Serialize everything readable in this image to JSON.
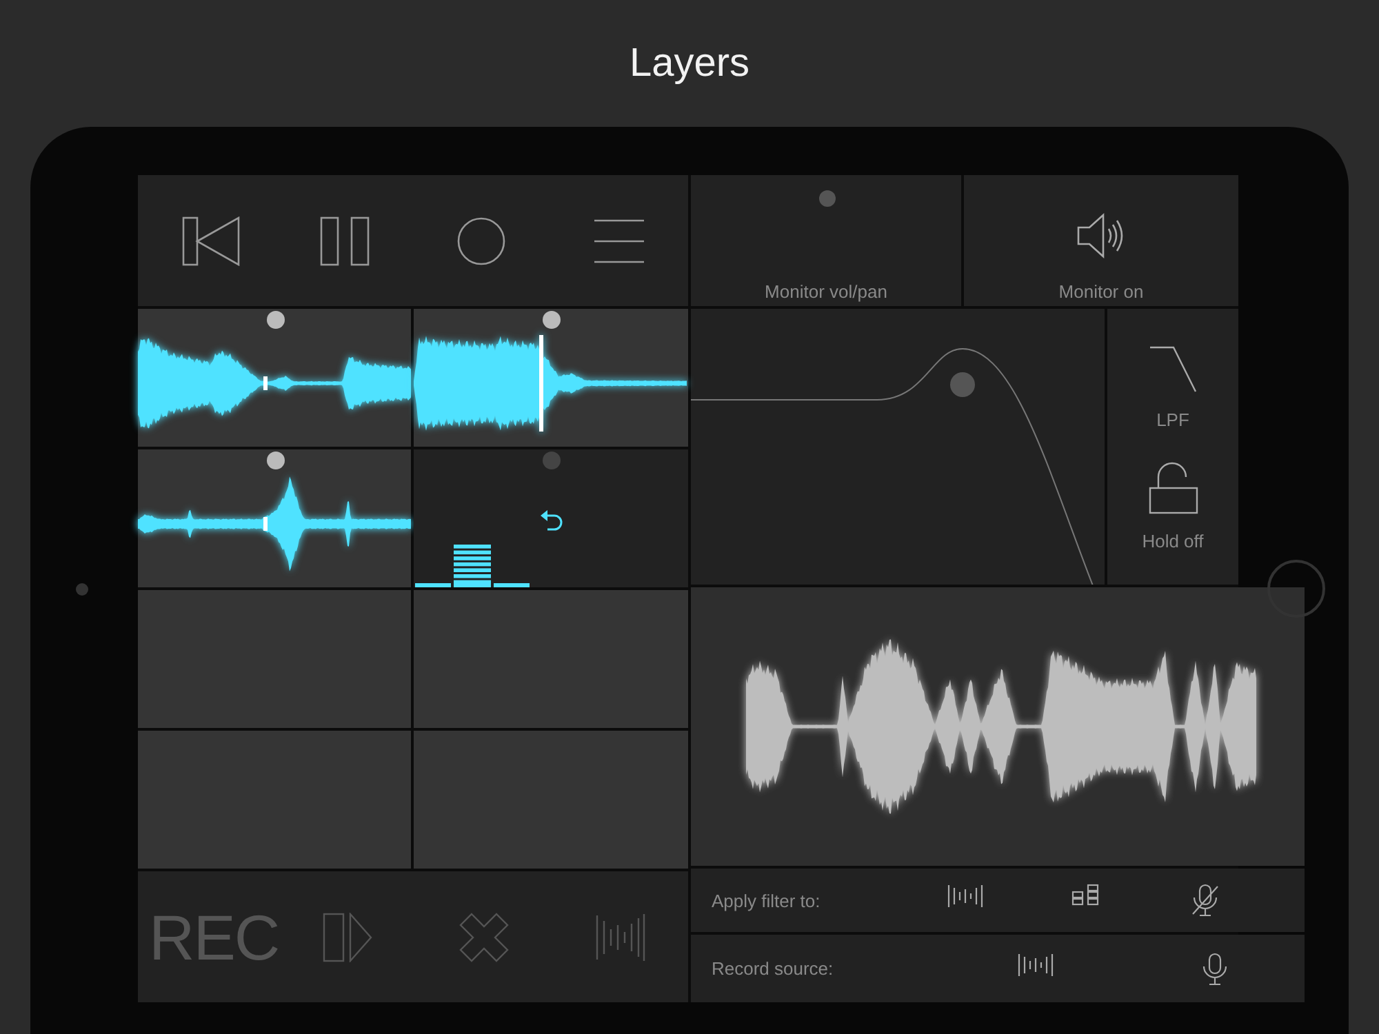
{
  "title": "Layers",
  "transport": [
    {
      "kind": "back"
    },
    {
      "kind": "pause"
    },
    {
      "kind": "record"
    },
    {
      "kind": "menu"
    }
  ],
  "pads": [
    {
      "kind": "wave",
      "dot_lit": true
    },
    {
      "kind": "wave",
      "dot_lit": true
    },
    {
      "kind": "wave",
      "dot_lit": true
    },
    {
      "kind": "loop",
      "dot_lit": false
    },
    {
      "kind": "empty"
    },
    {
      "kind": "empty"
    },
    {
      "kind": "empty"
    },
    {
      "kind": "empty"
    }
  ],
  "bottom_controls": [
    {
      "kind": "text",
      "label": "REC",
      "disabled": true
    },
    {
      "kind": "play",
      "disabled": true
    },
    {
      "kind": "delete",
      "disabled": true
    },
    {
      "kind": "wave",
      "disabled": true
    }
  ],
  "monitor": {
    "volpan_label": "Monitor vol/pan",
    "output_label": "Monitor on"
  },
  "filter": {
    "type_label": "LPF",
    "hold_label": "Hold off"
  },
  "apply_filter": {
    "label": "Apply filter to:",
    "options": [
      {
        "kind": "wave"
      },
      {
        "kind": "pads"
      },
      {
        "kind": "mic-off"
      }
    ]
  },
  "record_source": {
    "label": "Record source:",
    "options": [
      {
        "kind": "wave"
      },
      {
        "kind": "mic"
      }
    ]
  }
}
